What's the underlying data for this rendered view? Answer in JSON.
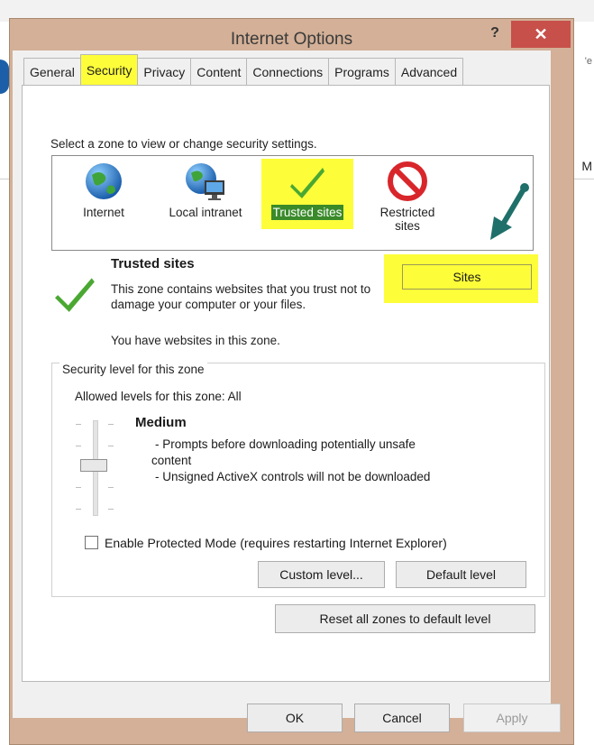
{
  "background": {
    "right_text_1": "'e",
    "right_text_2": "M"
  },
  "window": {
    "title": "Internet Options",
    "help_label": "?",
    "close_label": "✕"
  },
  "tabs": [
    {
      "label": "General"
    },
    {
      "label": "Security"
    },
    {
      "label": "Privacy"
    },
    {
      "label": "Content"
    },
    {
      "label": "Connections"
    },
    {
      "label": "Programs"
    },
    {
      "label": "Advanced"
    }
  ],
  "active_tab": "Security",
  "zones": {
    "prompt": "Select a zone to view or change security settings.",
    "items": [
      {
        "label": "Internet",
        "icon": "globe-icon"
      },
      {
        "label": "Local intranet",
        "icon": "intranet-icon"
      },
      {
        "label": "Trusted sites",
        "icon": "checkmark-icon"
      },
      {
        "label_line1": "Restricted",
        "label_line2": "sites",
        "icon": "restricted-icon"
      }
    ],
    "selected": "Trusted sites"
  },
  "zone_info": {
    "title": "Trusted sites",
    "description": "This zone contains websites that you trust not to damage your computer or your files.",
    "status": "You have websites in this zone."
  },
  "sites_button": "Sites",
  "security_level": {
    "legend": "Security level for this zone",
    "allowed": "Allowed levels for this zone: All",
    "level_name": "Medium",
    "desc_1": "- Prompts before downloading potentially unsafe",
    "desc_1b": "content",
    "desc_2": "- Unsigned ActiveX controls will not be downloaded"
  },
  "protected_mode": {
    "label": "Enable Protected Mode (requires restarting Internet Explorer)",
    "checked": false
  },
  "buttons": {
    "custom_level": "Custom level...",
    "default_level": "Default level",
    "reset_all": "Reset all zones to default level",
    "ok": "OK",
    "cancel": "Cancel",
    "apply": "Apply"
  },
  "colors": {
    "highlight": "#fdfd3a",
    "title_bar": "#d3b097",
    "close": "#c7504b",
    "selected_zone": "#3a8a2a",
    "arrow": "#1f6f6a"
  }
}
